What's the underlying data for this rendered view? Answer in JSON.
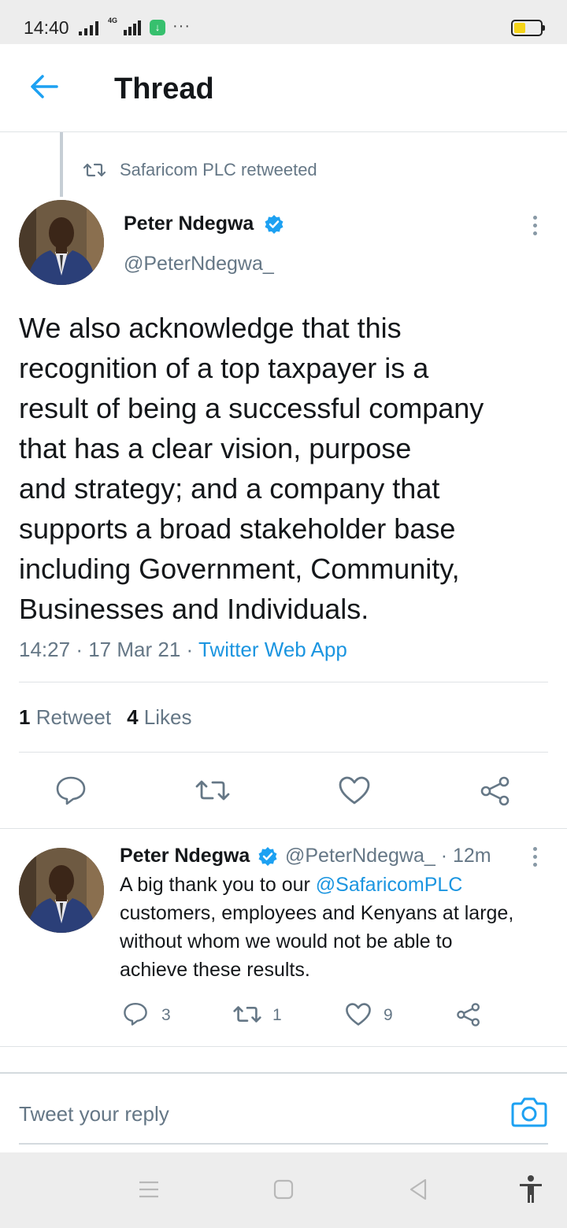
{
  "status_bar": {
    "time": "14:40",
    "network_label": "4G",
    "more": "···",
    "download_icon": "download-icon",
    "battery_color": "#f5d419"
  },
  "header": {
    "title": "Thread",
    "back_icon": "arrow-left-icon"
  },
  "retweet_context": {
    "text": "Safaricom PLC retweeted"
  },
  "main_tweet": {
    "author_name": "Peter Ndegwa",
    "author_handle": "@PeterNdegwa_",
    "body_lines": [
      "We also acknowledge that this",
      "recognition of a top taxpayer is a",
      "result of being a successful company",
      "that has a clear vision, purpose",
      "and strategy; and a company that",
      "supports a broad stakeholder base",
      "including Government, Community,",
      "Businesses and Individuals."
    ],
    "time": "14:27",
    "date": "17 Mar 21",
    "separator": "·",
    "source": "Twitter Web App",
    "retweet_count": "1",
    "retweet_label": "Retweet",
    "like_count": "4",
    "like_label": "Likes"
  },
  "reply_tweet": {
    "author_name": "Peter Ndegwa",
    "author_handle": "@PeterNdegwa_",
    "age": "· 12m",
    "body_prefix": "A big thank you to our ",
    "mention": "@SafaricomPLC",
    "body_lines": [
      "customers, employees and Kenyans at large,",
      "without whom we would not be able to",
      "achieve these results."
    ],
    "reply_count": "3",
    "retweet_count": "1",
    "like_count": "9"
  },
  "compose": {
    "placeholder": "Tweet your reply"
  },
  "colors": {
    "accent": "#1b95e0",
    "muted": "#657786",
    "verified": "#1da1f2"
  }
}
